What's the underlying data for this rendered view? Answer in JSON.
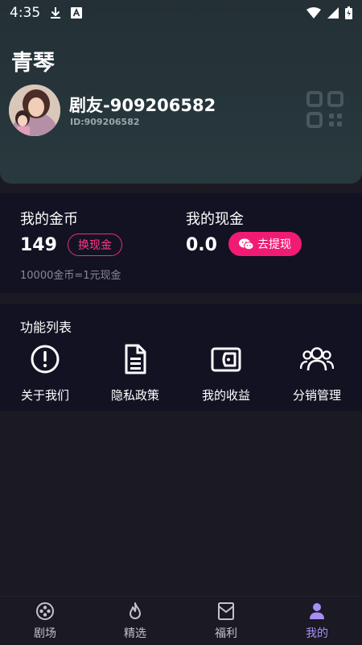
{
  "status_bar": {
    "time": "4:35"
  },
  "profile": {
    "app_name": "青琴",
    "nickname": "剧友-909206582",
    "user_id": "ID:909206582"
  },
  "wallet": {
    "coins": {
      "title": "我的金币",
      "value": "149",
      "button": "换现金"
    },
    "cash": {
      "title": "我的现金",
      "value": "0.0",
      "button": "去提现"
    },
    "rate_note": "10000金币=1元现金"
  },
  "features": {
    "title": "功能列表",
    "items": [
      {
        "label": "关于我们",
        "icon": "info-icon"
      },
      {
        "label": "隐私政策",
        "icon": "document-icon"
      },
      {
        "label": "我的收益",
        "icon": "wallet-icon"
      },
      {
        "label": "分销管理",
        "icon": "users-icon"
      }
    ]
  },
  "tabbar": {
    "items": [
      {
        "label": "剧场",
        "icon": "theater-icon",
        "active": false
      },
      {
        "label": "精选",
        "icon": "flame-icon",
        "active": false
      },
      {
        "label": "福利",
        "icon": "gift-box-icon",
        "active": false
      },
      {
        "label": "我的",
        "icon": "person-icon",
        "active": true
      }
    ]
  },
  "colors": {
    "accent_pink": "#f21b74",
    "active_tab": "#a88ef2",
    "panel": "#131223",
    "background": "#1b1a22"
  }
}
